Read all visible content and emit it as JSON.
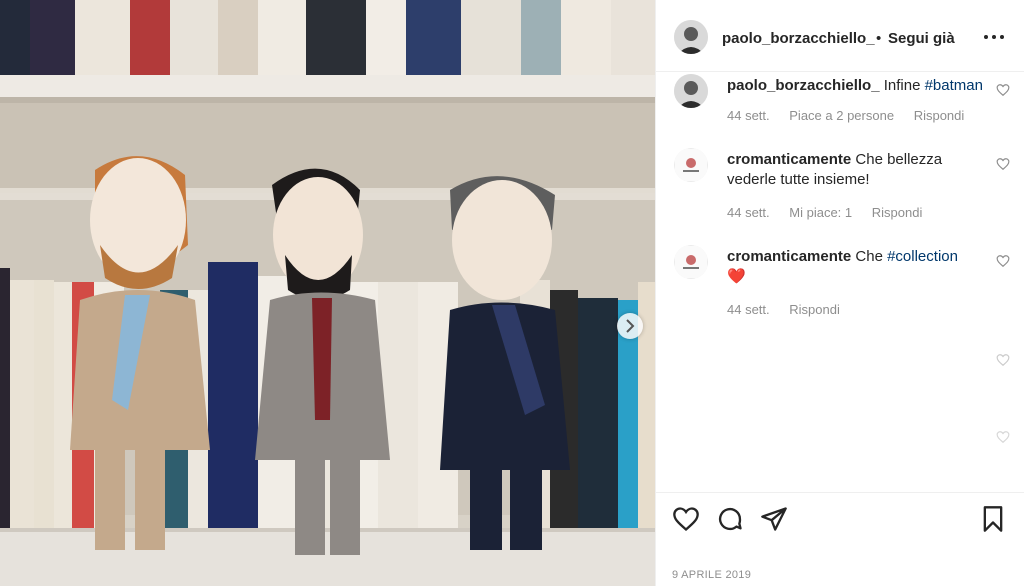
{
  "post": {
    "image_alt": "",
    "owner": {
      "username": "paolo_borzacchiello_",
      "separator": "•",
      "follow_label": "Segui già"
    }
  },
  "comments": [
    {
      "username": "paolo_borzacchiello_",
      "text": "Infine ",
      "tag": "#batman",
      "tail": "",
      "age": "44 sett.",
      "likes": "Piace a 2 persone",
      "reply": "Rispondi"
    },
    {
      "username": "cromanticamente",
      "text": "Che bellezza vederle tutte insieme!",
      "tag": "",
      "tail": "",
      "age": "44 sett.",
      "likes": "Mi piace: 1",
      "reply": "Rispondi"
    },
    {
      "username": "cromanticamente",
      "text": "Che ",
      "tag": "#collection",
      "tail": "❤️",
      "age": "44 sett.",
      "likes": "",
      "reply": "Rispondi"
    }
  ],
  "footer": {
    "date": "9 APRILE 2019"
  },
  "icons": {
    "like": "heart-icon",
    "comment": "comment-icon",
    "share": "paper-plane-icon",
    "save": "bookmark-icon",
    "more": "more-options-icon",
    "next": "chevron-right-icon"
  },
  "colors": {
    "link": "#00376b",
    "muted": "#8e8e8e",
    "text": "#262626",
    "heart": "#ed4956"
  }
}
